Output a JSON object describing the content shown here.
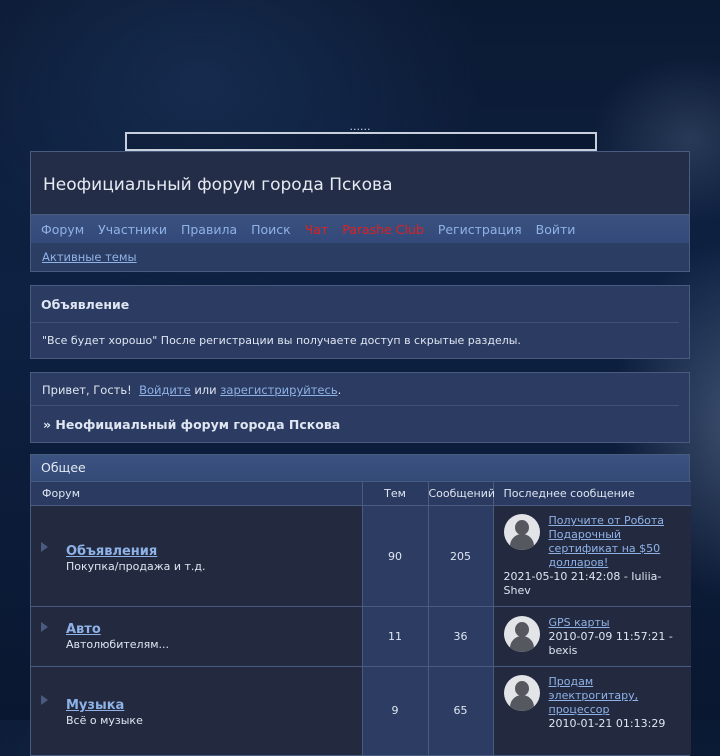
{
  "top": {
    "dots": "......"
  },
  "header": {
    "title": "Неофициальный форум города Пскова"
  },
  "nav": {
    "items": [
      {
        "label": "Форум"
      },
      {
        "label": "Участники"
      },
      {
        "label": "Правила"
      },
      {
        "label": "Поиск"
      },
      {
        "label": "Чат"
      },
      {
        "label": "Parashe Club"
      },
      {
        "label": "Регистрация"
      },
      {
        "label": "Войти"
      }
    ],
    "accent_color": "#e02020"
  },
  "subnav": {
    "active_topics": "Активные темы"
  },
  "announcement": {
    "title": "Объявление",
    "text": "\"Все будет хорошо\" После регистрации вы получаете доступ в скрытые разделы."
  },
  "welcome": {
    "greeting": "Привет, Гость!",
    "login": "Войдите",
    "or": "или",
    "register": "зарегистрируйтесь",
    "dot": "."
  },
  "breadcrumb": "» Неофициальный форум города Пскова",
  "category": {
    "title": "Общее",
    "columns": {
      "forum": "Форум",
      "topics": "Тем",
      "posts": "Сообщений",
      "last": "Последнее сообщение"
    },
    "forums": [
      {
        "name": "Объявления",
        "desc": "Покупка/продажа и т.д.",
        "topics": "90",
        "posts": "205",
        "last_title": "Получите от Робота Подарочный сертификат на $50 долларов!",
        "last_meta": "2021-05-10 21:42:08 - Iuliia-Shev"
      },
      {
        "name": "Авто",
        "desc": "Автолюбителям...",
        "topics": "11",
        "posts": "36",
        "last_title": "GPS карты",
        "last_meta": "2010-07-09 11:57:21 - bexis"
      },
      {
        "name": "Музыка",
        "desc": "Всё о музыке",
        "topics": "9",
        "posts": "65",
        "last_title": "Продам электрогитару, процессор",
        "last_meta": "2010-01-21 01:13:29"
      }
    ]
  }
}
